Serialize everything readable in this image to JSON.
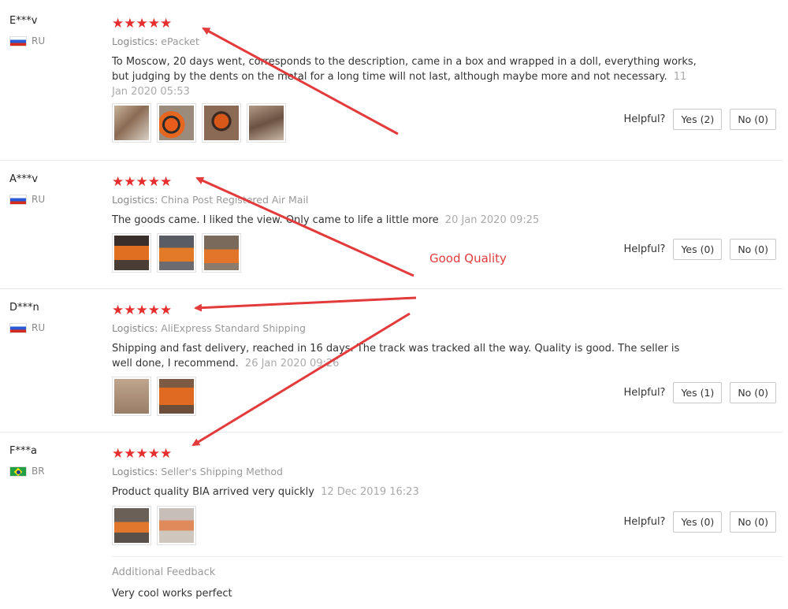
{
  "reviews": [
    {
      "name": "E***v",
      "country": "RU",
      "stars": "★★★★★",
      "logistics_label": "Logistics:",
      "logistics_value": "ePacket",
      "text": "To Moscow, 20 days went, corresponds to the description, came in a box and wrapped in a doll, everything works, but judging by the dents on the metal for a long time will not last, although maybe more and not necessary.",
      "date": "11 Jan 2020 05:53",
      "helpful_label": "Helpful?",
      "yes": "Yes (2)",
      "no": "No (0)"
    },
    {
      "name": "A***v",
      "country": "RU",
      "stars": "★★★★★",
      "logistics_label": "Logistics:",
      "logistics_value": "China Post Registered Air Mail",
      "text": "The goods came. I liked the view. Only came to life a little more",
      "date": "20 Jan 2020 09:25",
      "helpful_label": "Helpful?",
      "yes": "Yes (0)",
      "no": "No (0)"
    },
    {
      "name": "D***n",
      "country": "RU",
      "stars": "★★★★★",
      "logistics_label": "Logistics:",
      "logistics_value": "AliExpress Standard Shipping",
      "text": "Shipping and fast delivery, reached in 16 days. The track was tracked all the way. Quality is good. The seller is well done, I recommend.",
      "date": "26 Jan 2020 09:26",
      "helpful_label": "Helpful?",
      "yes": "Yes (1)",
      "no": "No (0)"
    },
    {
      "name": "F***a",
      "country": "BR",
      "stars": "★★★★★",
      "logistics_label": "Logistics:",
      "logistics_value": "Seller's Shipping Method",
      "text": "Product quality BIA arrived very quickly",
      "date": "12 Dec 2019 16:23",
      "helpful_label": "Helpful?",
      "yes": "Yes (0)",
      "no": "No (0)",
      "additional_feedback_title": "Additional Feedback",
      "additional_feedback_text": "Very cool works perfect"
    }
  ],
  "annotation": {
    "label": "Good Quality",
    "color": "#e33b3b"
  },
  "colors": {
    "star": "#e62e2e",
    "muted_text": "#999999",
    "border": "#e8e8e8"
  }
}
